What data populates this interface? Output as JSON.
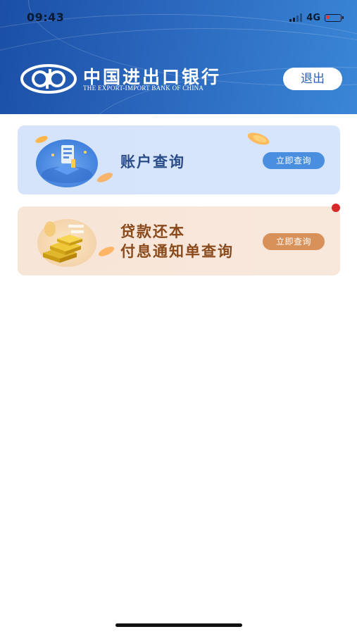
{
  "status_bar": {
    "time": "09:43",
    "network": "4G",
    "battery_level": 0.2
  },
  "header": {
    "bank_name_cn": "中国进出口银行",
    "bank_name_en": "THE EXPORT-IMPORT BANK OF CHINA",
    "logout_label": "退出"
  },
  "cards": [
    {
      "title_lines": [
        "账户查询"
      ],
      "button_label": "立即查询",
      "icon": "account-query-illustration",
      "accent": "#4a8ee0"
    },
    {
      "title_lines": [
        "贷款还本",
        "付息通知单查询"
      ],
      "button_label": "立即查询",
      "icon": "gold-bars-illustration",
      "accent": "#d9915a",
      "has_notification_dot": true
    }
  ],
  "colors": {
    "header_blue": "#2a67bd",
    "account_card_bg": "#d5e3fb",
    "loan_card_bg": "#f7e5d7",
    "notification_dot": "#d62a2a"
  }
}
